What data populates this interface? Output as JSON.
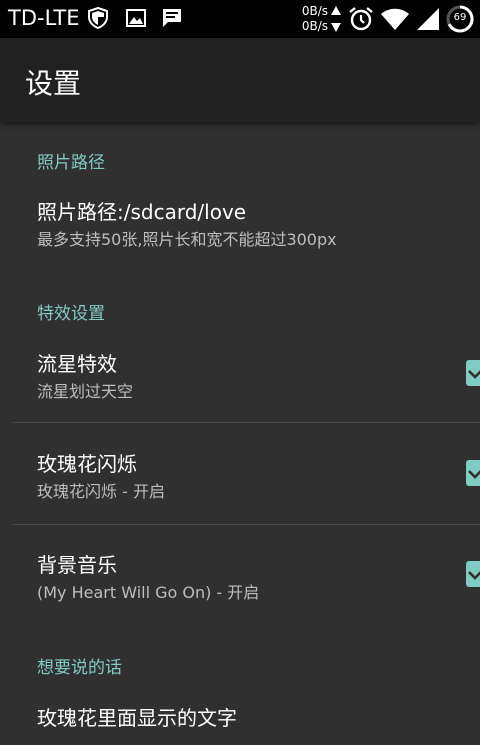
{
  "status_bar": {
    "carrier": "TD-LTE",
    "speed_up": "0B/s",
    "speed_down": "0B/s",
    "battery_level": "69",
    "icons": [
      "shield-icon",
      "image-icon",
      "message-icon",
      "alarm-icon",
      "wifi-icon",
      "signal-icon",
      "battery-icon"
    ]
  },
  "app_bar": {
    "title": "设置"
  },
  "accent_color": "#80cbc4",
  "categories": {
    "photo_path": "照片路径",
    "effects": "特效设置",
    "words": "想要说的话"
  },
  "prefs": {
    "photo_path": {
      "title": "照片路径:/sdcard/love",
      "summary": "最多支持50张,照片长和宽不能超过300px"
    },
    "meteor": {
      "title": "流星特效",
      "summary": "流星划过天空",
      "checked": true
    },
    "rose_flash": {
      "title": "玫瑰花闪烁",
      "summary": "玫瑰花闪烁 - 开启",
      "checked": true
    },
    "bg_music": {
      "title": "背景音乐",
      "summary": "(My Heart Will Go On) - 开启",
      "checked": true
    },
    "rose_text": {
      "title": "玫瑰花里面显示的文字"
    }
  }
}
